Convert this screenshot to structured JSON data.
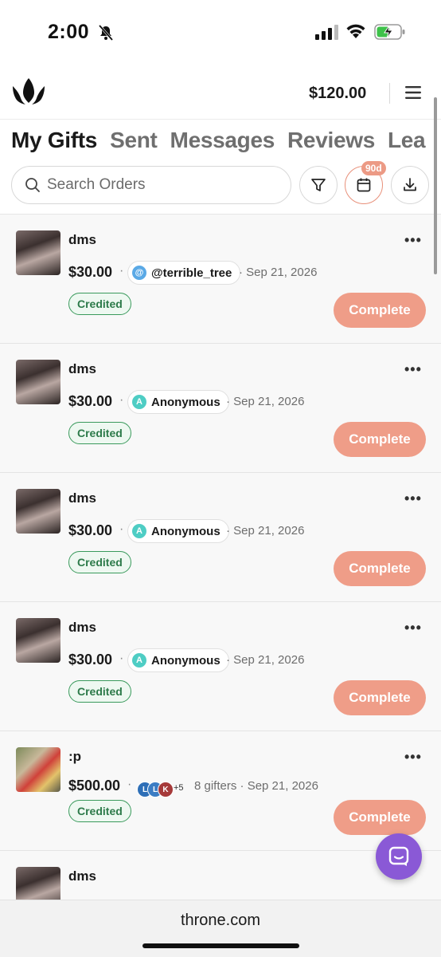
{
  "status_bar": {
    "time": "2:00"
  },
  "header": {
    "balance": "$120.00"
  },
  "tabs": [
    {
      "label": "My Gifts",
      "active": true
    },
    {
      "label": "Sent"
    },
    {
      "label": "Messages"
    },
    {
      "label": "Reviews"
    },
    {
      "label": "Lea"
    }
  ],
  "search": {
    "placeholder": "Search Orders"
  },
  "date_filter": {
    "badge": "90d"
  },
  "orders": [
    {
      "title": "dms",
      "amount": "$30.00",
      "sender": "@terrible_tree",
      "sender_initial": "@",
      "sender_color": "#5aa9e6",
      "date": "Sep 21, 2026",
      "status": "Credited",
      "action": "Complete"
    },
    {
      "title": "dms",
      "amount": "$30.00",
      "sender": "Anonymous",
      "sender_initial": "A",
      "sender_color": "#4ecdc4",
      "date": "Sep 21, 2026",
      "status": "Credited",
      "action": "Complete"
    },
    {
      "title": "dms",
      "amount": "$30.00",
      "sender": "Anonymous",
      "sender_initial": "A",
      "sender_color": "#4ecdc4",
      "date": "Sep 21, 2026",
      "status": "Credited",
      "action": "Complete"
    },
    {
      "title": "dms",
      "amount": "$30.00",
      "sender": "Anonymous",
      "sender_initial": "A",
      "sender_color": "#4ecdc4",
      "date": "Sep 21, 2026",
      "status": "Credited",
      "action": "Complete"
    },
    {
      "title": ":p",
      "amount": "$500.00",
      "gifter_initials": [
        "L",
        "L",
        "K"
      ],
      "gifter_colors": [
        "#2e6fb7",
        "#3b7dc4",
        "#a63a3a"
      ],
      "gifters_more": "+5",
      "gifters_label": "8 gifters",
      "date": "Sep 21, 2026",
      "status": "Credited",
      "action": "Complete"
    },
    {
      "title": "dms"
    }
  ],
  "browser": {
    "domain": "throne.com"
  },
  "colors": {
    "accent": "#ef9d88",
    "credited": "#3a9a5c",
    "chat": "#8a59d6"
  }
}
